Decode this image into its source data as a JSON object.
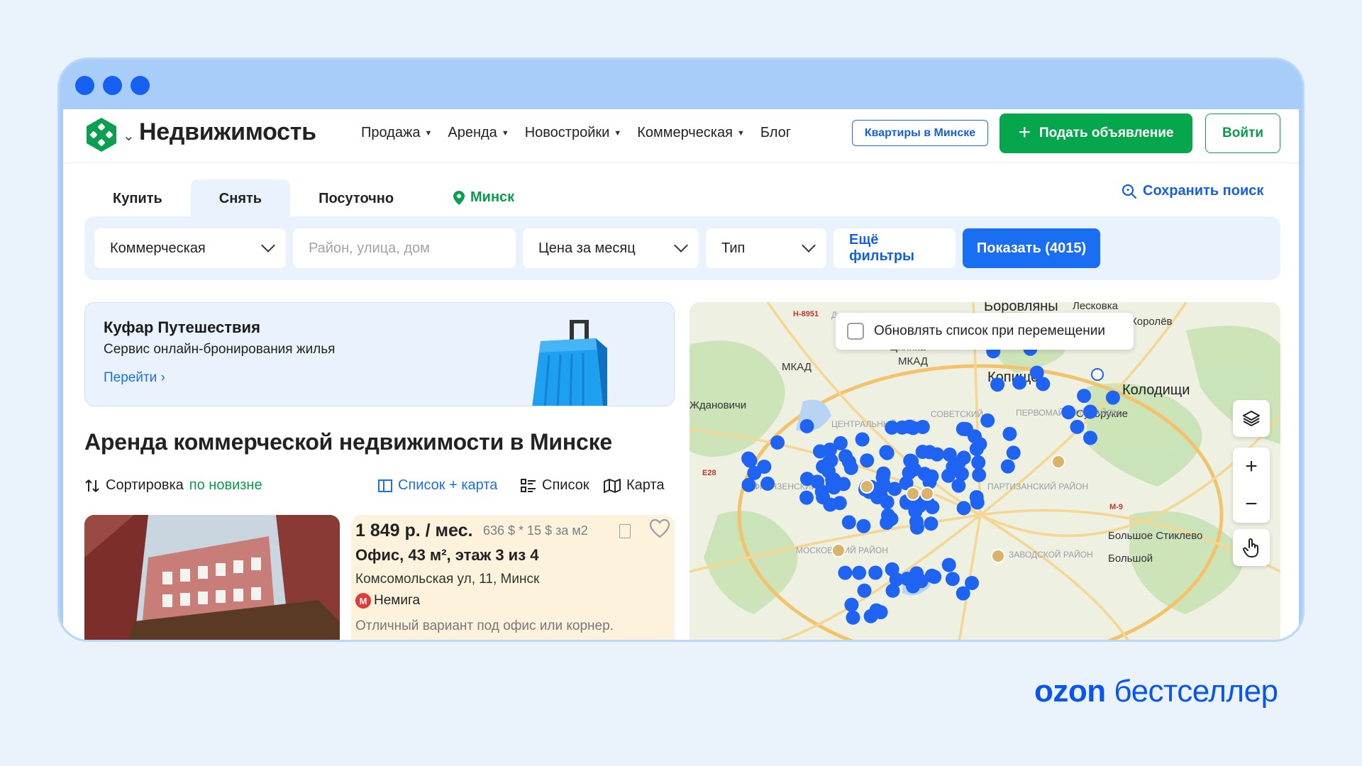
{
  "header": {
    "brand": "Недвижимость",
    "nav": [
      "Продажа",
      "Аренда",
      "Новостройки",
      "Коммерческая",
      "Блог"
    ],
    "nav_has_caret": [
      true,
      true,
      true,
      true,
      false
    ],
    "apartments_button": "Квартиры в Минске",
    "post_ad_button": "Подать объявление",
    "login_button": "Войти"
  },
  "search": {
    "tabs": [
      "Купить",
      "Снять",
      "Посуточно"
    ],
    "active_tab": "Снять",
    "city": "Минск",
    "save_search": "Сохранить поиск",
    "category": "Коммерческая",
    "address_placeholder": "Район, улица, дом",
    "price": "Цена за месяц",
    "type": "Тип",
    "more_filters": "Ещё фильтры",
    "show_button": "Показать (4015)"
  },
  "promo": {
    "title": "Куфар Путешествия",
    "subtitle": "Сервис онлайн-бронирования жилья",
    "link": "Перейти"
  },
  "page_title": "Аренда коммерческой недвижимости в Минске",
  "sort": {
    "label": "Сортировка",
    "value": "по новизне"
  },
  "views": [
    "Список + карта",
    "Список",
    "Карта"
  ],
  "active_view": "Список + карта",
  "listing": {
    "price": "1 849 р. / мес.",
    "price_extra": "636 $ * 15 $ за м2",
    "title": "Офис, 43 м², этаж 3 из 4",
    "address": "Комсомольская ул, 11, Минск",
    "metro": "Немига",
    "description": "Отличный вариант под офис или корнер."
  },
  "map": {
    "update_on_move": "Обновлять список при перемещении",
    "labels": [
      "Боровляны",
      "Лесковка",
      "Королёв",
      "Цнянка",
      "МКАД",
      "МКАД",
      "Копище",
      "Колодищи",
      "Ждановичи",
      "Сухорукие",
      "ЦЕНТРАЛЬНЫЙ РАЙОН",
      "СОВЕТСКИЙ",
      "ПЕРВОМАЙСКИЙ РАЙОН",
      "ФРУНЗЕНСКИЙ РАЙОН",
      "ПАРТИЗАНСКИЙ РАЙОН",
      "МОСКОВСКИЙ РАЙОН",
      "ЗАВОДСКОЙ РАЙОН",
      "Большое Стиклево",
      "Большой",
      "Дроздово",
      "Н-8951",
      "E28",
      "M-9"
    ],
    "zoom_in": "+",
    "zoom_out": "−"
  },
  "footer_brand": {
    "ozon": "ozon",
    "rest": "бестселлер"
  },
  "colors": {
    "accent_blue": "#1a6ef2",
    "accent_green": "#06a64d",
    "map_marker": "#1f63f2",
    "background": "#eaf2fc"
  }
}
